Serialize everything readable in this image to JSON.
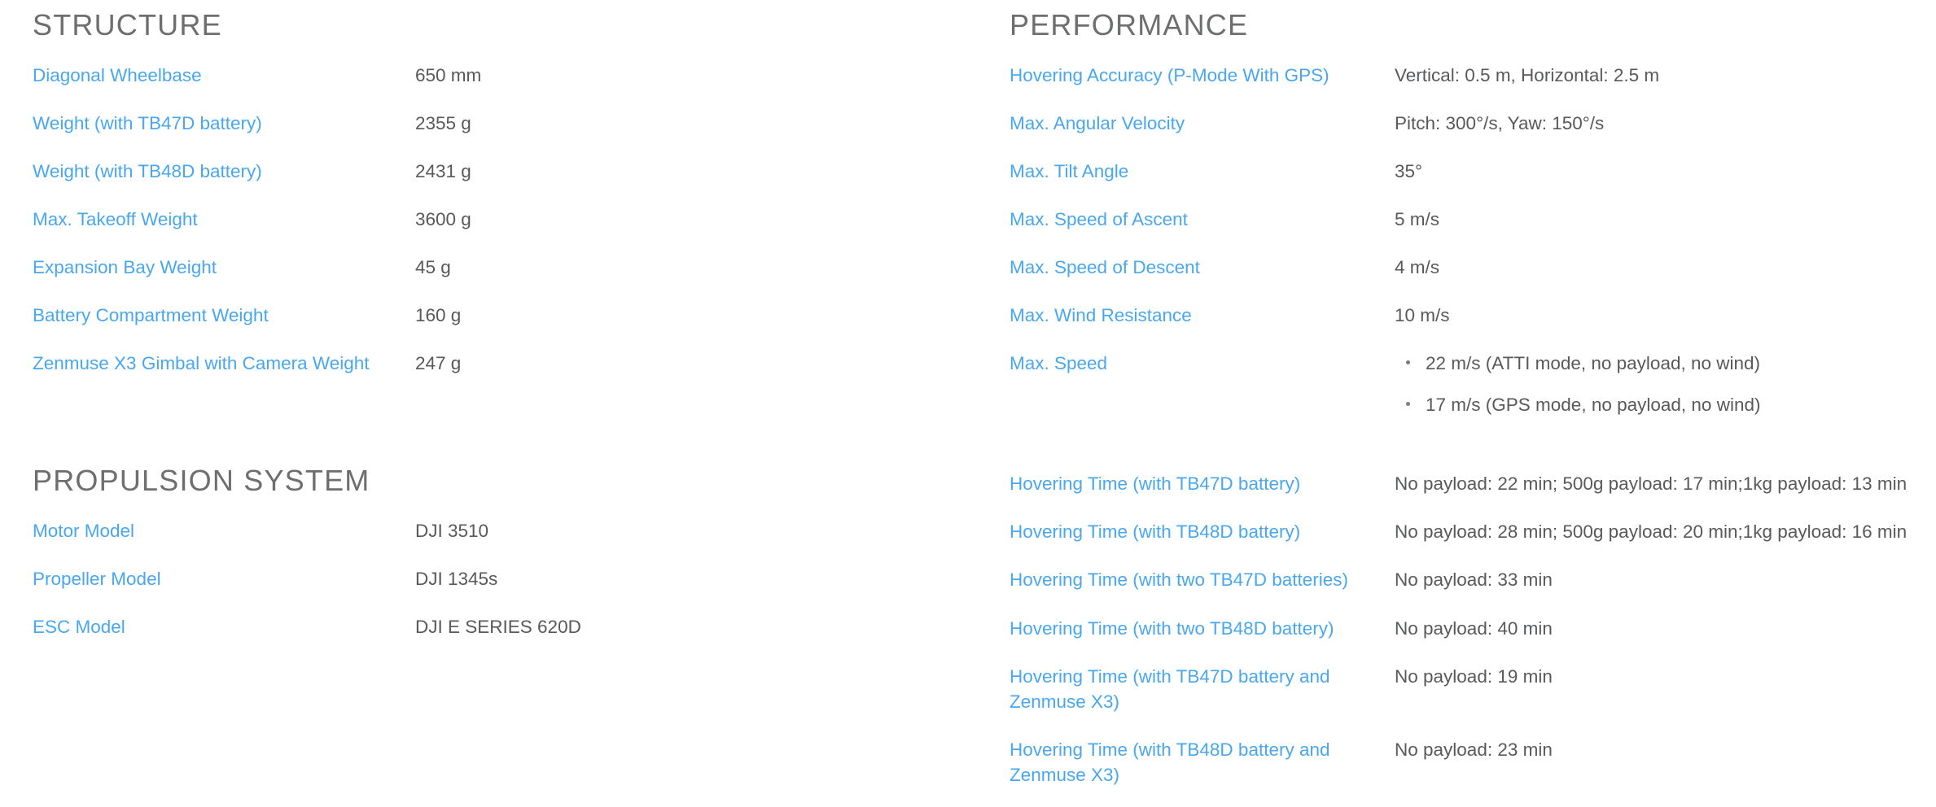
{
  "colors": {
    "link": "#49a7ef",
    "heading": "#6d6e70",
    "value": "#58595b",
    "background": "#ffffff"
  },
  "left_column": {
    "sections": [
      {
        "title": "STRUCTURE",
        "rows": [
          {
            "label": "Diagonal Wheelbase",
            "value": "650 mm"
          },
          {
            "label": "Weight (with TB47D battery)",
            "value": "2355 g"
          },
          {
            "label": "Weight (with TB48D battery)",
            "value": "2431 g"
          },
          {
            "label": "Max. Takeoff Weight",
            "value": "3600 g"
          },
          {
            "label": "Expansion Bay Weight",
            "value": "45 g"
          },
          {
            "label": "Battery Compartment Weight",
            "value": "160 g"
          },
          {
            "label": "Zenmuse X3 Gimbal with Camera Weight",
            "value": "247 g"
          }
        ]
      },
      {
        "title": "PROPULSION SYSTEM",
        "rows": [
          {
            "label": "Motor Model",
            "value": "DJI 3510"
          },
          {
            "label": "Propeller Model",
            "value": "DJI 1345s"
          },
          {
            "label": "ESC Model",
            "value": "DJI E SERIES 620D"
          }
        ]
      }
    ]
  },
  "right_column": {
    "sections": [
      {
        "title": "PERFORMANCE",
        "rows": [
          {
            "label": "Hovering Accuracy (P-Mode With GPS)",
            "value": "Vertical: 0.5 m, Horizontal: 2.5 m"
          },
          {
            "label": "Max. Angular Velocity",
            "value": "Pitch: 300°/s, Yaw: 150°/s"
          },
          {
            "label": "Max. Tilt Angle",
            "value": "35°"
          },
          {
            "label": "Max. Speed of Ascent",
            "value": "5 m/s"
          },
          {
            "label": "Max. Speed of Descent",
            "value": "4 m/s"
          },
          {
            "label": "Max. Wind Resistance",
            "value": "10 m/s"
          },
          {
            "label": "Max. Speed",
            "bullets": [
              "22 m/s (ATTI mode, no payload, no wind)",
              "17 m/s (GPS mode, no payload, no wind)"
            ]
          },
          {
            "label": "Hovering Time (with TB47D battery)",
            "value": "No payload: 22 min; 500g payload: 17 min;1kg payload: 13 min"
          },
          {
            "label": "Hovering Time (with TB48D battery)",
            "value": "No payload: 28 min; 500g payload: 20 min;1kg payload: 16 min"
          },
          {
            "label": "Hovering Time (with two TB47D batteries)",
            "value": "No payload: 33 min"
          },
          {
            "label": "Hovering Time (with two TB48D battery)",
            "value": "No payload: 40 min"
          },
          {
            "label": "Hovering Time (with TB47D battery and Zenmuse X3)",
            "value": "No payload: 19 min"
          },
          {
            "label": "Hovering Time (with TB48D battery and Zenmuse X3)",
            "value": "No payload: 23 min"
          }
        ]
      }
    ]
  }
}
